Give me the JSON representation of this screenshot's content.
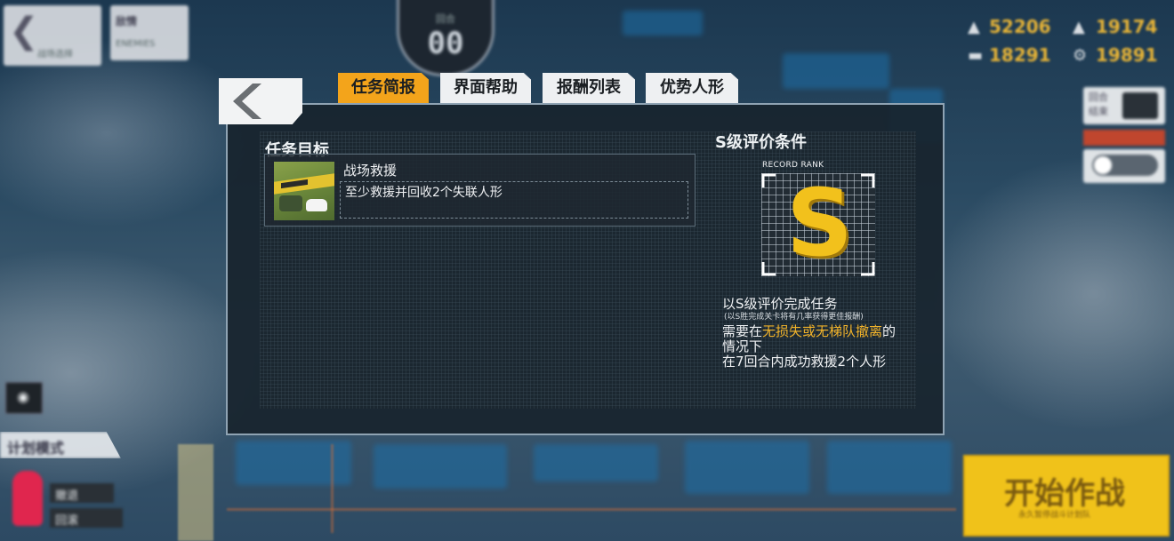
{
  "timer": {
    "label": "回合",
    "value": "00"
  },
  "top_left": {
    "back_label": "战场选择",
    "second_label": "敌情",
    "second_sub": "ENEMIES"
  },
  "resources": [
    {
      "icon": "manpower-icon",
      "value": "52206"
    },
    {
      "icon": "ammo-icon",
      "value": "19174"
    },
    {
      "icon": "ration-icon",
      "value": "18291"
    },
    {
      "icon": "parts-icon",
      "value": "19891"
    }
  ],
  "side_right": {
    "label1": "回合",
    "label2": "结束"
  },
  "bottom_left": {
    "mode_label": "计划模式",
    "item1": "撤退",
    "item2": "回滚"
  },
  "start_button": {
    "label": "开始作战",
    "sub": "永久暂停战斗计划队"
  },
  "tabs": [
    {
      "label": "任务简报",
      "active": true
    },
    {
      "label": "界面帮助",
      "active": false
    },
    {
      "label": "报酬列表",
      "active": false
    },
    {
      "label": "优势人形",
      "active": false
    }
  ],
  "objectives": {
    "title": "任务目标",
    "mission_name": "战场救援",
    "mission_desc": "至少救援并回收2个失联人形"
  },
  "s_rank": {
    "title": "S级评价条件",
    "record_label": "RECORD RANK",
    "rank_letter": "S",
    "cond_title": "以S级评价完成任务",
    "cond_note": "(以S胜完成关卡将有几率获得更佳报酬)",
    "line1_pre": "需要在",
    "line1_highlight": "无损失或无梯队撤离",
    "line1_post": "的",
    "line2": "情况下",
    "line3": "在7回合内成功救援2个人形"
  },
  "colors": {
    "accent": "#f3a41b",
    "highlight": "#f3b42a",
    "start": "#f0c21a"
  }
}
